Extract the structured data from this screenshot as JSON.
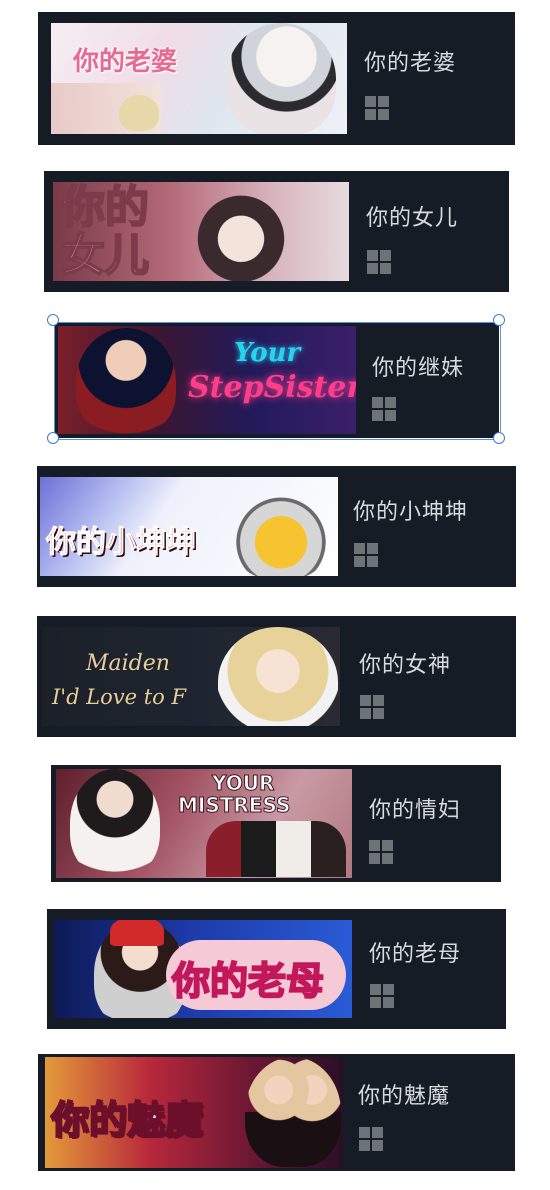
{
  "games": [
    {
      "title": "你的老婆",
      "capsule_text": "你的老婆",
      "platform_icon": "windows-icon"
    },
    {
      "title": "你的女儿",
      "capsule_text": "你的女儿",
      "platform_icon": "windows-icon"
    },
    {
      "title": "你的继妹",
      "capsule_text": "Your StepSister",
      "platform_icon": "windows-icon",
      "selected": true
    },
    {
      "title": "你的小坤坤",
      "capsule_text": "你的小坤坤",
      "platform_icon": "windows-icon"
    },
    {
      "title": "你的女神",
      "capsule_text": "Maiden I'd Love to F",
      "platform_icon": "windows-icon"
    },
    {
      "title": "你的情妇",
      "capsule_text": "YOUR MISTRESS",
      "platform_icon": "windows-icon"
    },
    {
      "title": "你的老母",
      "capsule_text": "你的老母",
      "platform_icon": "windows-icon"
    },
    {
      "title": "你的魅魔",
      "capsule_text": "你的魅魔",
      "platform_icon": "windows-icon"
    }
  ],
  "capsule_lines": {
    "c3a": "Your",
    "c3b": "StepSister",
    "c5a": "Maiden",
    "c5b": "I'd Love to F",
    "c6a": "YOUR",
    "c6b": "MISTRESS"
  },
  "colors": {
    "card_bg": "#161c26",
    "title_text": "#d7dbe0",
    "icon_gray": "#6e7378",
    "selection_blue": "#3d7ae0"
  }
}
